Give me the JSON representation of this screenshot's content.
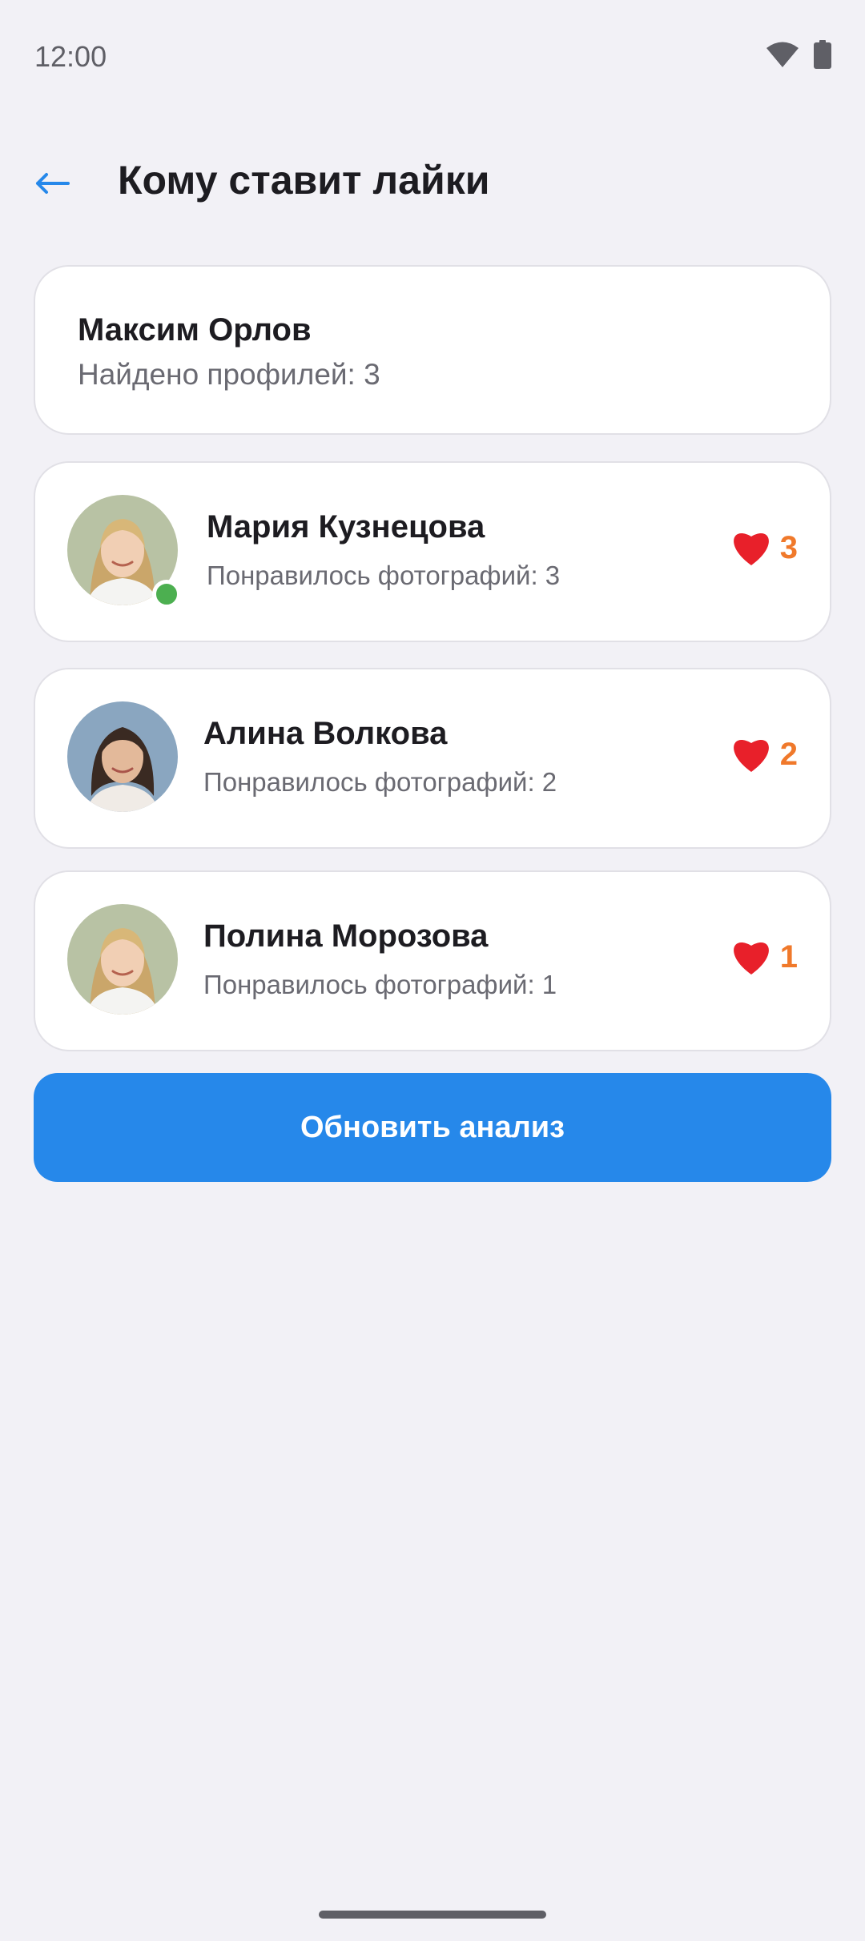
{
  "status_bar": {
    "time": "12:00",
    "icons": [
      "wifi-icon",
      "battery-icon"
    ]
  },
  "header": {
    "back_icon": "arrow-left-icon",
    "title": "Кому ставит лайки"
  },
  "summary": {
    "name": "Максим Орлов",
    "found_profiles": "Найдено профилей: 3"
  },
  "profiles": [
    {
      "name": "Мария Кузнецова",
      "subtitle": "Понравилось фотографий: 3",
      "likes": "3",
      "online": true
    },
    {
      "name": "Алина Волкова",
      "subtitle": "Понравилось фотографий: 2",
      "likes": "2",
      "online": false
    },
    {
      "name": "Полина Морозова",
      "subtitle": "Понравилось фотографий: 1",
      "likes": "1",
      "online": false
    }
  ],
  "actions": {
    "refresh_label": "Обновить анализ"
  },
  "colors": {
    "accent": "#2688EA",
    "like_count": "#F0792B",
    "heart": "#E8202A",
    "online": "#4CAF50",
    "background": "#F2F1F6"
  }
}
